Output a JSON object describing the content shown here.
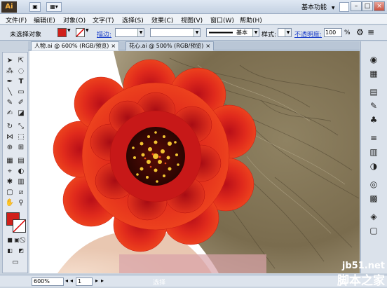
{
  "titlebar": {
    "app_logo": "Ai",
    "workspace": "基本功能",
    "workspace_arrow": "▼"
  },
  "menu": {
    "items": [
      "文件(F)",
      "编辑(E)",
      "对象(O)",
      "文字(T)",
      "选择(S)",
      "效果(C)",
      "视图(V)",
      "窗口(W)",
      "帮助(H)"
    ]
  },
  "control_bar": {
    "selection_status": "未选择对象",
    "stroke_label": "描边:",
    "brush_label": "基本",
    "style_label": "样式:",
    "opacity_label": "不透明度:",
    "opacity_value": "100",
    "opacity_unit": "%",
    "fill_color": "#d0201a"
  },
  "tabs": [
    {
      "label": "人物.ai @ 600% (RGB/预览)",
      "close": "×"
    },
    {
      "label": "花心.ai @ 500% (RGB/预览)",
      "close": "×"
    }
  ],
  "statusbar": {
    "zoom": "600%",
    "page": "1",
    "status_text": "选择"
  },
  "watermark": {
    "site": "jb51.net",
    "name": "脚本之家"
  },
  "colors": {
    "flower_outer": "#e8321a",
    "flower_inner": "#c8141a",
    "flower_center": "#4a0a05",
    "stamen": "#f2c431",
    "hair": "#8a7a5c"
  }
}
